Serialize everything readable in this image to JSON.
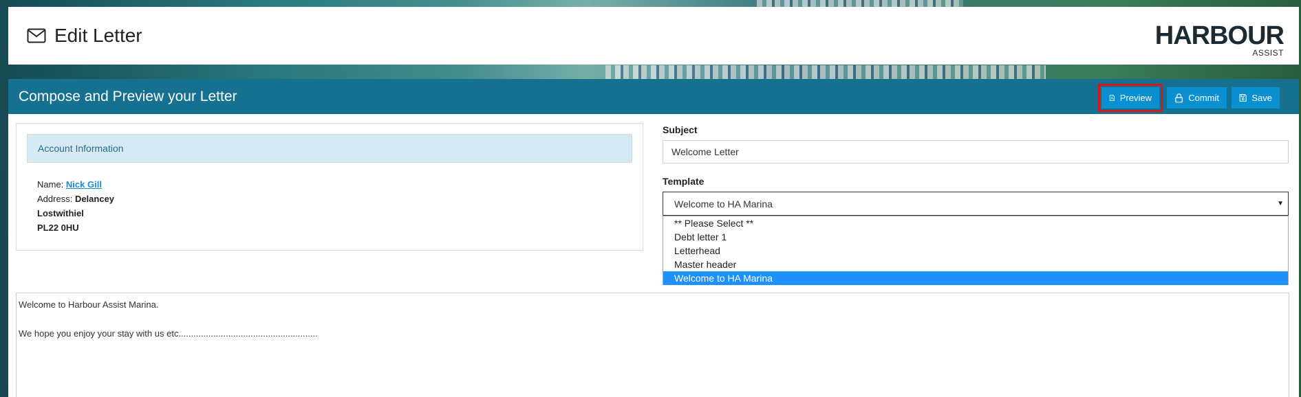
{
  "header": {
    "title": "Edit Letter",
    "icon": "envelope-icon",
    "logo_main": "HARBOUR",
    "logo_sub": "ASSIST"
  },
  "panel": {
    "title": "Compose and Preview your Letter",
    "buttons": {
      "preview": "Preview",
      "commit": "Commit",
      "save": "Save"
    }
  },
  "account": {
    "heading": "Account Information",
    "name_label": "Name:",
    "name_value": "Nick Gill",
    "address_label": "Address:",
    "address_line1": "Delancey",
    "address_line2": "Lostwithiel",
    "address_line3": "PL22 0HU"
  },
  "subject": {
    "label": "Subject",
    "value": "Welcome Letter"
  },
  "template": {
    "label": "Template",
    "selected": "Welcome to HA Marina",
    "options": [
      "** Please Select **",
      "Debt letter 1",
      "Letterhead",
      "Master header",
      "Welcome to HA Marina"
    ]
  },
  "letter_body": {
    "line1": "Welcome to Harbour Assist Marina.",
    "line2": "We hope you enjoy your stay with us etc........................................................"
  },
  "colors": {
    "panel_header": "#16708f",
    "button": "#0a8fd0",
    "highlight_outline": "#d8161b",
    "dropdown_selected": "#1e90ff"
  }
}
